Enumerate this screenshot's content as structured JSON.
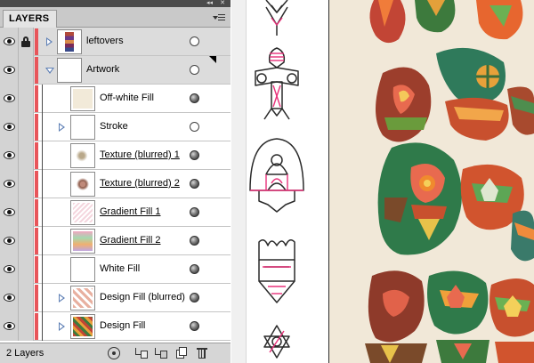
{
  "panel": {
    "tab_label": "LAYERS",
    "title_controls": {
      "collapse_glyph": "◂◂",
      "close_glyph": "✕"
    },
    "layer_color": "#e8555a",
    "layers": [
      {
        "name": "leftovers",
        "level": "top",
        "visible": true,
        "locked": true,
        "expanded": false,
        "target": "hollow",
        "selected_art": false,
        "underline": false,
        "thumb": "leftovers"
      },
      {
        "name": "Artwork",
        "level": "top",
        "visible": true,
        "locked": false,
        "expanded": true,
        "target": "hollow",
        "selected_art": true,
        "underline": false,
        "thumb": "blank"
      },
      {
        "name": "Off-white Fill",
        "level": "child",
        "visible": true,
        "locked": false,
        "expandable": false,
        "target": "filled",
        "underline": false,
        "thumb": "offwhite"
      },
      {
        "name": "Stroke",
        "level": "child",
        "visible": true,
        "locked": false,
        "expandable": true,
        "target": "hollow",
        "underline": false,
        "thumb": "blank"
      },
      {
        "name": "Texture (blurred) 1",
        "level": "child",
        "visible": true,
        "locked": false,
        "expandable": false,
        "target": "filled",
        "underline": true,
        "thumb": "texture1"
      },
      {
        "name": "Texture (blurred) 2",
        "level": "child",
        "visible": true,
        "locked": false,
        "expandable": false,
        "target": "filled",
        "underline": true,
        "thumb": "texture2"
      },
      {
        "name": "Gradient Fill 1",
        "level": "child",
        "visible": true,
        "locked": false,
        "expandable": false,
        "target": "filled",
        "underline": true,
        "thumb": "gradient1"
      },
      {
        "name": "Gradient Fill 2",
        "level": "child",
        "visible": true,
        "locked": false,
        "expandable": false,
        "target": "filled",
        "underline": true,
        "thumb": "gradient2"
      },
      {
        "name": "White Fill",
        "level": "child",
        "visible": true,
        "locked": false,
        "expandable": false,
        "target": "filled",
        "underline": false,
        "thumb": "blank"
      },
      {
        "name": "Design Fill (blurred)",
        "level": "child",
        "visible": true,
        "locked": false,
        "expandable": true,
        "target": "filled",
        "underline": false,
        "thumb": "design_blur"
      },
      {
        "name": "Design Fill",
        "level": "child",
        "visible": true,
        "locked": false,
        "expandable": true,
        "target": "filled",
        "underline": false,
        "thumb": "design"
      }
    ],
    "status": {
      "layer_count": "2 Layers",
      "buttons": [
        "locate-object-icon",
        "make-clipping-mask-icon",
        "create-sublayer-icon",
        "create-new-layer-icon",
        "delete-layer-icon"
      ]
    }
  },
  "canvas": {
    "pasteboard_color": "#f0f0f0",
    "artboard_color": "#f1e8d8",
    "stroke_colors": {
      "line": "#2a2a2a",
      "accent": "#e8317a"
    }
  }
}
